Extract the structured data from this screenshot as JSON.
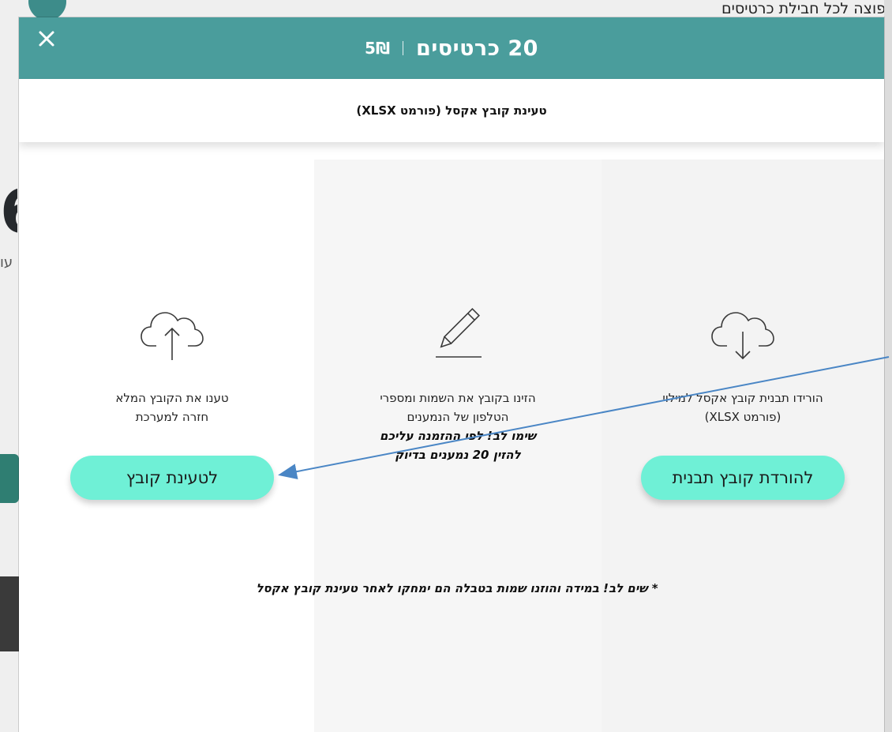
{
  "background": {
    "top_text": "פוצה לכל חבילת כרטיסים",
    "big_digit": "6",
    "small_label": "עו"
  },
  "modal": {
    "title": "20 כרטיסים",
    "price": "5₪",
    "subheader": "טעינת קובץ אקסל (פורמט XLSX)",
    "columns": {
      "download": {
        "icon": "cloud-download-icon",
        "line1": "הורידו תבנית קובץ אקסל למילוי",
        "line2": "(פורמט XLSX)",
        "button": "להורדת קובץ תבנית"
      },
      "fill": {
        "icon": "pencil-icon",
        "line1": "הזינו בקובץ את השמות ומספרי",
        "line2": "הטלפון של הנמענים",
        "warn1": "שימו לב! לפי ההזמנה עליכם",
        "warn2": "להזין 20 נמענים בדיוק"
      },
      "upload": {
        "icon": "cloud-upload-icon",
        "line1": "טענו את הקובץ המלא",
        "line2": "חזרה למערכת",
        "button": "לטעינת קובץ"
      }
    },
    "footer_note": "* שים לב! במידה והוזנו שמות בטבלה הם ימחקו לאחר טעינת קובץ אקסל"
  },
  "colors": {
    "header": "#4a9d9c",
    "button": "#6ff0d6",
    "arrow": "#4a86c5"
  }
}
